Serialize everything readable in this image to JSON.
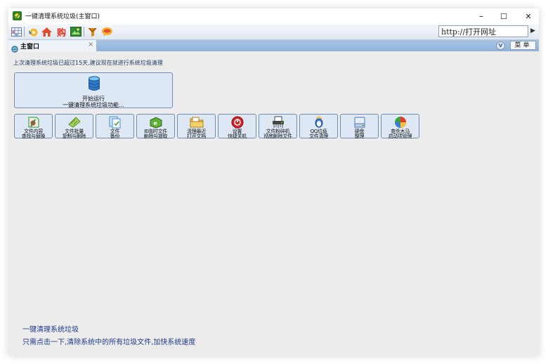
{
  "window": {
    "title": "一键清理系统垃圾(主窗口)",
    "controls": [
      "–",
      "☐",
      "✕"
    ]
  },
  "toolbar": {
    "icons": [
      "grid-icon",
      "refresh-icon",
      "home-icon",
      "shop-icon",
      "image-icon",
      "heart-icon",
      "chat-icon"
    ],
    "shop_label": "购",
    "url_placeholder": "http://打开网址"
  },
  "tabs": [
    {
      "label": "主窗口",
      "close": "×"
    }
  ],
  "tabbar": {
    "v_label": "V",
    "menu_label": "菜单"
  },
  "main": {
    "notice": "上次清理系统垃圾已超过15天,建议现在就进行系统垃圾清理",
    "start_button": {
      "line1": "开始运行",
      "line2": "一键清理系统垃圾功能..."
    },
    "tools": [
      {
        "line1": "文件内容",
        "line2": "查找与替换",
        "icon": "find-replace-icon",
        "color": "#3a8f3a"
      },
      {
        "line1": "文件批量",
        "line2": "复制与删除",
        "icon": "batch-copy-icon",
        "color": "#6aa83a"
      },
      {
        "line1": "文件",
        "line2": "备份",
        "icon": "backup-icon",
        "color": "#4a8fc9"
      },
      {
        "line1": "IE临时文件",
        "line2": "删除与提取",
        "icon": "ie-temp-icon",
        "color": "#55a030"
      },
      {
        "line1": "清理最近",
        "line2": "打开文档",
        "icon": "folder-icon",
        "color": "#e7b23a"
      },
      {
        "line1": "设置",
        "line2": "快捷关机",
        "icon": "power-icon",
        "color": "#d62020"
      },
      {
        "line1": "文件粉碎机",
        "line2": "彻底删除文件",
        "icon": "shredder-icon",
        "color": "#444444"
      },
      {
        "line1": "QQ垃圾",
        "line2": "文件清理",
        "icon": "qq-clean-icon",
        "color": "#3a7fd0"
      },
      {
        "line1": "硬盘",
        "line2": "整理",
        "icon": "disk-icon",
        "color": "#4a78b8"
      },
      {
        "line1": "查杀木马",
        "line2": "启动项管理",
        "icon": "trojan-icon",
        "color": "#3aa040"
      }
    ]
  },
  "footer": {
    "title": "一键清理系统垃圾",
    "description": "只需点击一下,清除系统中的所有垃圾文件,加快系统速度"
  }
}
